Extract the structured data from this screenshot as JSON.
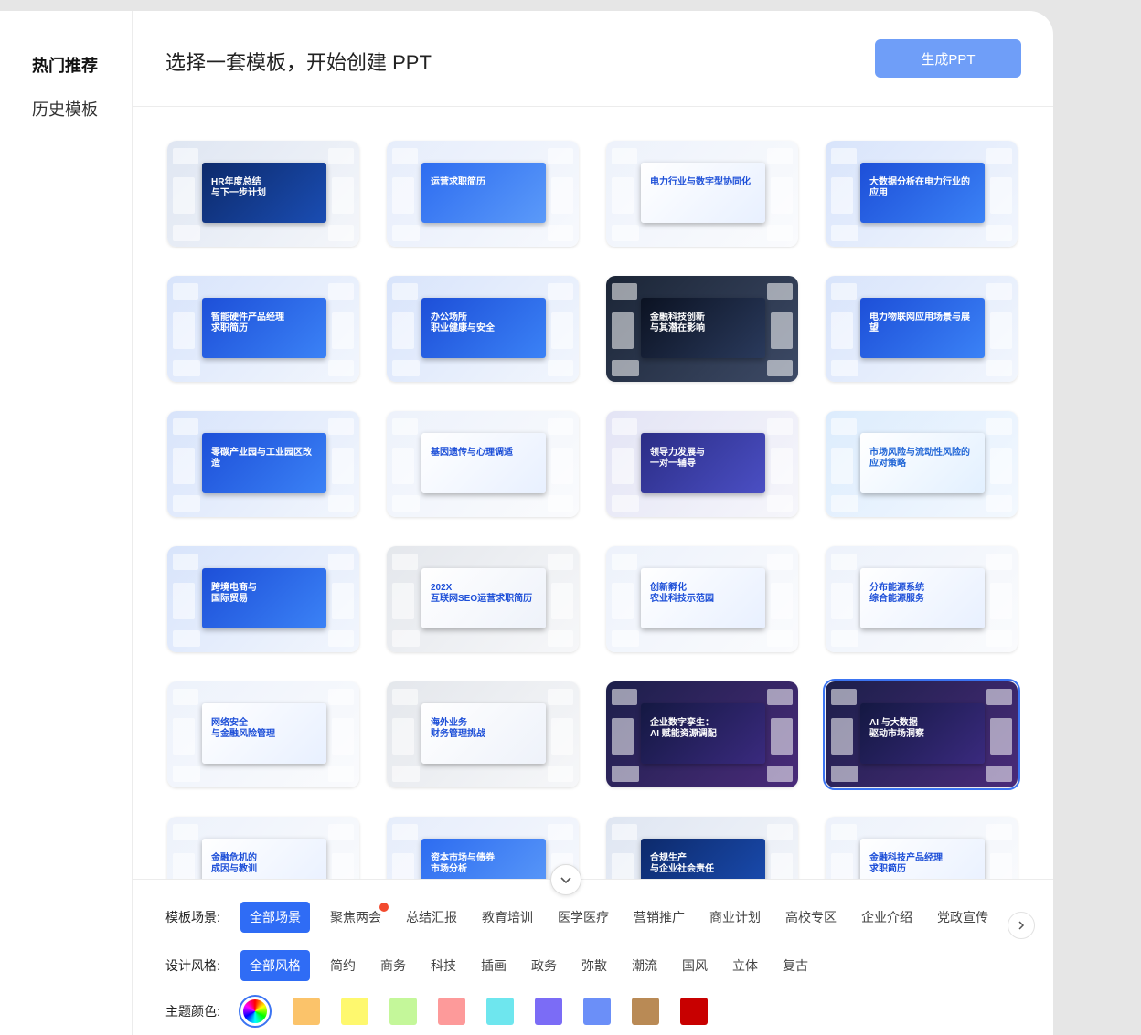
{
  "sidebar": {
    "items": [
      {
        "label": "热门推荐"
      },
      {
        "label": "历史模板"
      }
    ]
  },
  "header": {
    "title": "选择一套模板，开始创建 PPT",
    "generate_label": "生成PPT"
  },
  "templates": [
    {
      "title": "HR年度总结\n与下一步计划",
      "theme": "navy"
    },
    {
      "title": "运营求职简历",
      "theme": "blue-light"
    },
    {
      "title": "电力行业与数字型协同化",
      "theme": "light"
    },
    {
      "title": "大数据分析在电力行业的应用",
      "theme": "blue"
    },
    {
      "title": "智能硬件产品经理\n求职简历",
      "theme": "blue"
    },
    {
      "title": "办公场所\n职业健康与安全",
      "theme": "blue"
    },
    {
      "title": "金融科技创新\n与其潜在影响",
      "theme": "dark"
    },
    {
      "title": "电力物联网应用场景与展望",
      "theme": "blue"
    },
    {
      "title": "零碳产业园与工业园区改造",
      "theme": "blue"
    },
    {
      "title": "基因遗传与心理调适",
      "theme": "light"
    },
    {
      "title": "领导力发展与\n一对一辅导",
      "theme": "indigo"
    },
    {
      "title": "市场风险与流动性风险的应对策略",
      "theme": "sky"
    },
    {
      "title": "跨境电商与\n国际贸易",
      "theme": "blue"
    },
    {
      "title": "202X\n互联网SEO运营求职简历",
      "theme": "gray"
    },
    {
      "title": "创新孵化\n农业科技示范园",
      "theme": "light"
    },
    {
      "title": "分布能源系统\n综合能源服务",
      "theme": "light"
    },
    {
      "title": "网络安全\n与金融风险管理",
      "theme": "light"
    },
    {
      "title": "海外业务\n财务管理挑战",
      "theme": "gray"
    },
    {
      "title": "企业数字孪生：\nAI 赋能资源调配",
      "theme": "purple"
    },
    {
      "title": "AI 与大数据\n驱动市场洞察",
      "theme": "purple"
    },
    {
      "title": "金融危机的\n成因与教训",
      "theme": "light"
    },
    {
      "title": "资本市场与债券\n市场分析",
      "theme": "blue-light"
    },
    {
      "title": "合规生产\n与企业社会责任",
      "theme": "navy"
    },
    {
      "title": "金融科技产品经理\n求职简历",
      "theme": "light"
    }
  ],
  "filters": {
    "scene_label": "模板场景:",
    "scenes": [
      "全部场景",
      "聚焦两会",
      "总结汇报",
      "教育培训",
      "医学医疗",
      "营销推广",
      "商业计划",
      "高校专区",
      "企业介绍",
      "党政宣传"
    ],
    "style_label": "设计风格:",
    "styles": [
      "全部风格",
      "简约",
      "商务",
      "科技",
      "插画",
      "政务",
      "弥散",
      "潮流",
      "国风",
      "立体",
      "复古"
    ],
    "color_label": "主题颜色:",
    "colors": [
      "#fbc36a",
      "#fef86e",
      "#c4f79a",
      "#fd9a9a",
      "#6ee6ee",
      "#7b6cf6",
      "#6b8ff8",
      "#b98a55",
      "#c80000"
    ]
  },
  "icons": {
    "collapse": "chevron-down-icon",
    "next": "chevron-right-icon",
    "color_all": "rainbow-icon"
  }
}
